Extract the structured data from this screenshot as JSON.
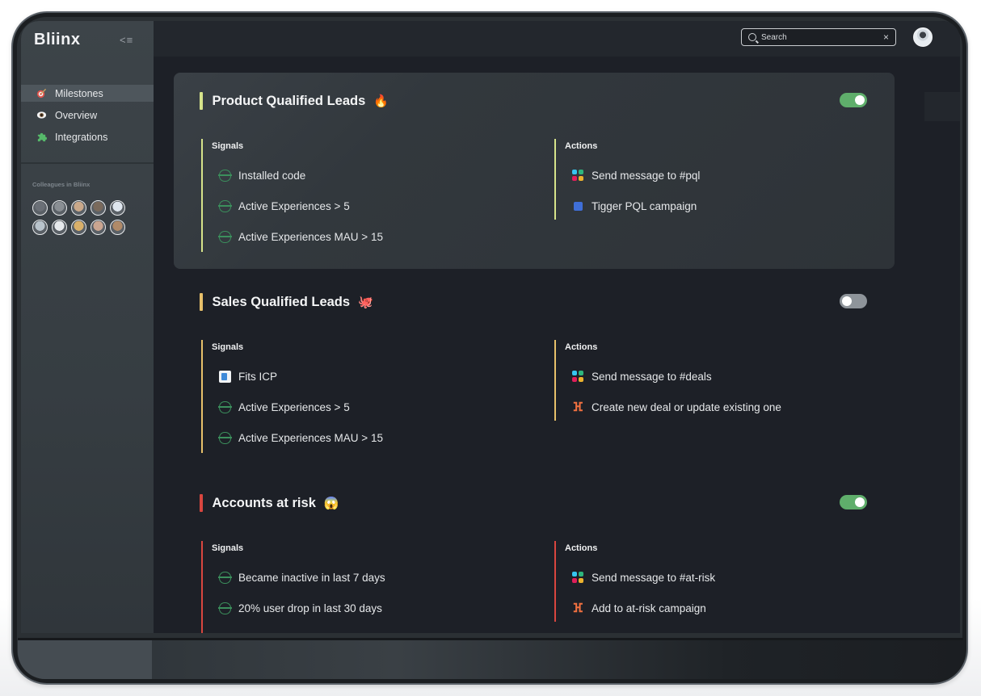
{
  "app": {
    "logo": "Bliinx",
    "collapse_label": "<≡"
  },
  "sidebar": {
    "items": [
      {
        "label": "Milestones",
        "icon": "target-icon",
        "active": true
      },
      {
        "label": "Overview",
        "icon": "eye-icon",
        "active": false
      },
      {
        "label": "Integrations",
        "icon": "puzzle-icon",
        "active": false
      }
    ],
    "colleagues_label": "Colleagues in Bliinx",
    "colleague_avatar_colors": [
      "#6b7077",
      "#8a8f94",
      "#c9a88a",
      "#7a6a5c",
      "#dfe6ee",
      "#b9c4cc",
      "#e6e9ec",
      "#d9b06a",
      "#caa590",
      "#b08a68"
    ]
  },
  "topbar": {
    "search_placeholder": "Search",
    "close_glyph": "×"
  },
  "milestones": [
    {
      "title": "Product Qualified Leads",
      "emoji": "🔥",
      "accent": "#d6e38a",
      "enabled": true,
      "signals_header": "Signals",
      "actions_header": "Actions",
      "signals": [
        {
          "icon": "segment-icon",
          "label": "Installed code"
        },
        {
          "icon": "segment-icon",
          "label": "Active Experiences > 5"
        },
        {
          "icon": "segment-icon",
          "label": "Active Experiences MAU > 15"
        }
      ],
      "actions": [
        {
          "icon": "slack-icon",
          "label": "Send message to #pql"
        },
        {
          "icon": "campaign-icon",
          "label": "Tigger PQL campaign"
        }
      ]
    },
    {
      "title": "Sales Qualified Leads",
      "emoji": "🐙",
      "accent": "#e7c06a",
      "enabled": false,
      "signals_header": "Signals",
      "actions_header": "Actions",
      "signals": [
        {
          "icon": "icp-icon",
          "label": "Fits ICP"
        },
        {
          "icon": "segment-icon",
          "label": "Active Experiences > 5"
        },
        {
          "icon": "segment-icon",
          "label": "Active Experiences MAU > 15"
        }
      ],
      "actions": [
        {
          "icon": "slack-icon",
          "label": "Send message to #deals"
        },
        {
          "icon": "hubspot-icon",
          "label": "Create new deal or update existing one"
        }
      ]
    },
    {
      "title": "Accounts at risk",
      "emoji": "😱",
      "accent": "#d9463f",
      "enabled": true,
      "signals_header": "Signals",
      "actions_header": "Actions",
      "signals": [
        {
          "icon": "segment-icon",
          "label": "Became inactive in last 7 days"
        },
        {
          "icon": "segment-icon",
          "label": "20% user drop in last 30 days"
        }
      ],
      "actions": [
        {
          "icon": "slack-icon",
          "label": "Send message to #at-risk"
        },
        {
          "icon": "hubspot-icon",
          "label": "Add to at-risk campaign"
        }
      ]
    }
  ]
}
